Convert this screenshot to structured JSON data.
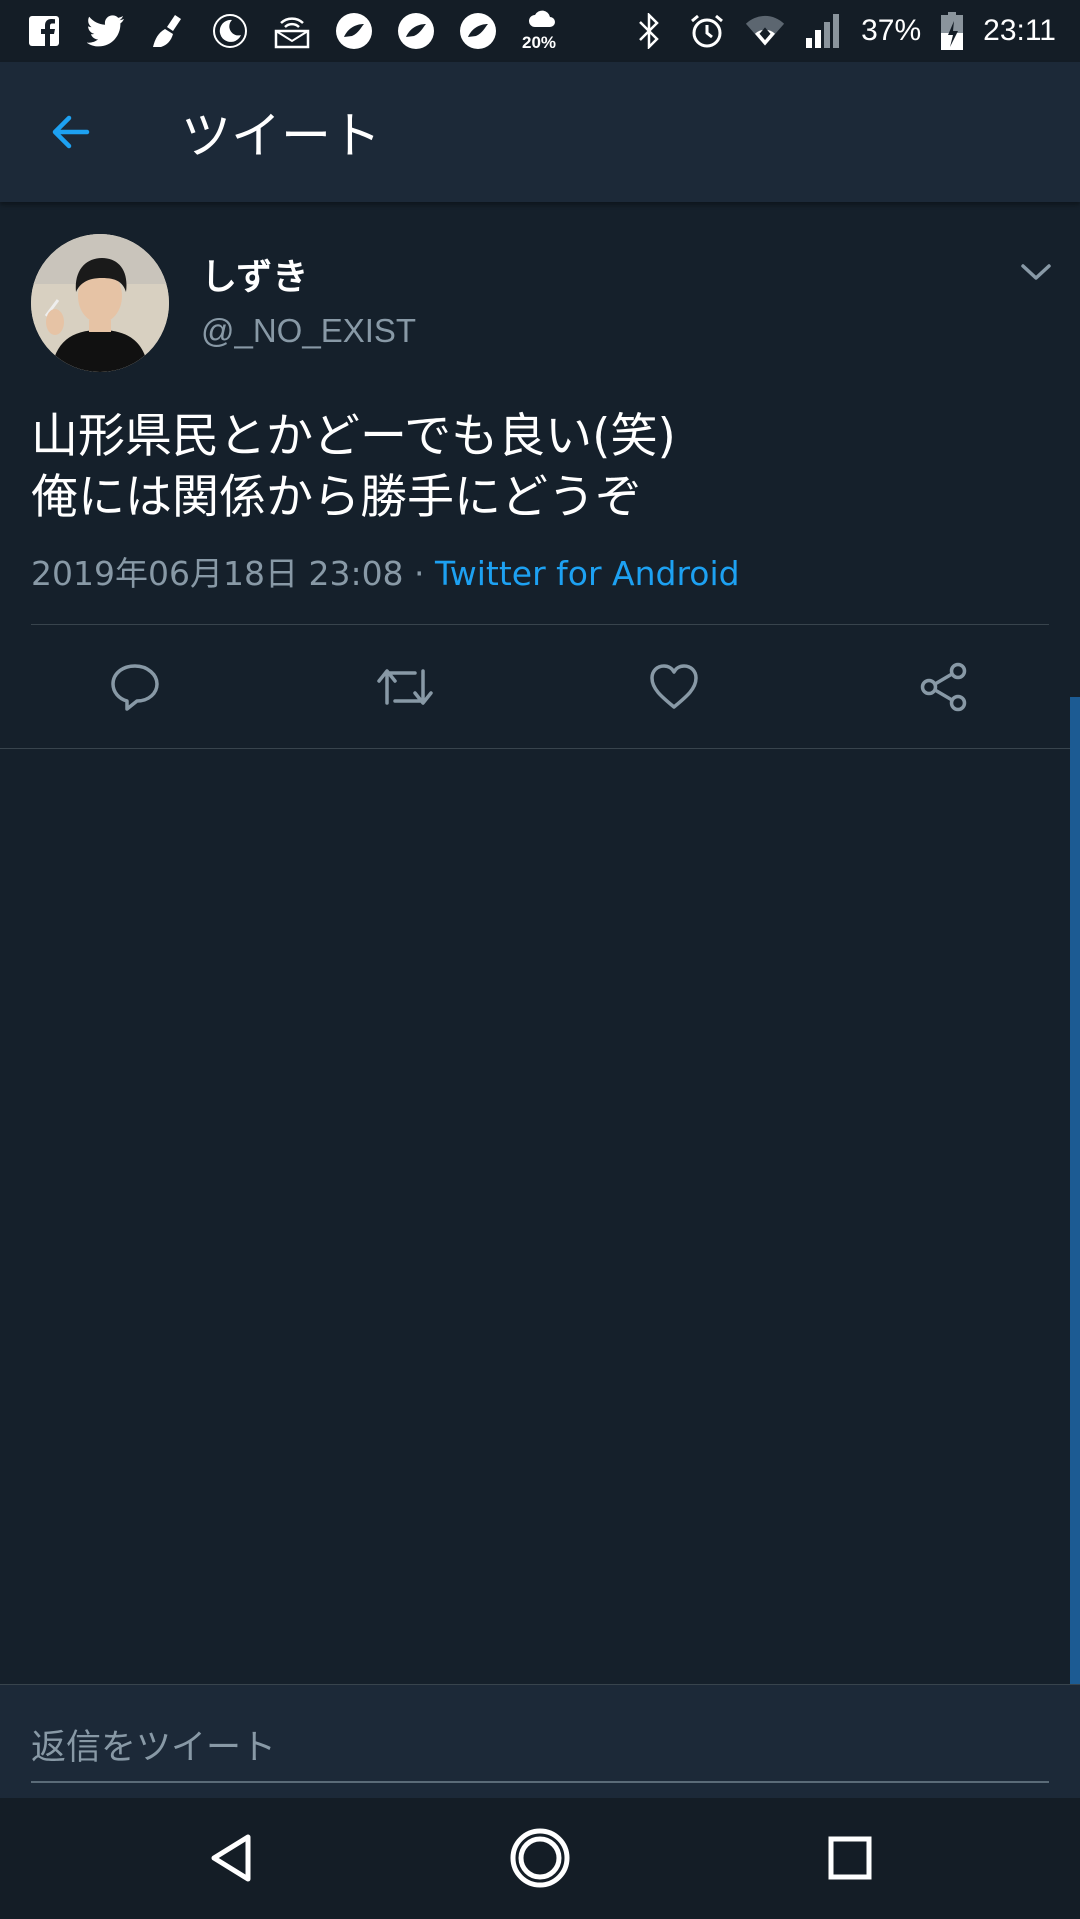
{
  "status_bar": {
    "battery": "37%",
    "time": "23:11",
    "weather_percent": "20%",
    "left_icons": [
      "facebook-icon",
      "twitter-icon",
      "cleaner-icon",
      "moon-icon",
      "wifi-mail-icon",
      "app-circle-icon",
      "app-circle-icon",
      "app-circle-icon",
      "weather-icon"
    ],
    "right_icons": [
      "bluetooth-icon",
      "alarm-icon",
      "wifi-icon",
      "signal-icon",
      "battery-icon"
    ]
  },
  "app_bar": {
    "title": "ツイート"
  },
  "tweet": {
    "display_name": "しずき",
    "handle": "@_NO_EXIST",
    "text_lines": [
      "山形県民とかどーでも良い(笑)",
      "俺には関係から勝手にどうぞ"
    ],
    "timestamp": "2019年06月18日 23:08",
    "separator": " · ",
    "source": "Twitter for Android"
  },
  "reply": {
    "placeholder": "返信をツイート"
  },
  "colors": {
    "background": "#15202b",
    "bar": "#1c2938",
    "accent": "#1da1f2",
    "secondary_text": "#8899a6",
    "divider": "#38444d"
  }
}
